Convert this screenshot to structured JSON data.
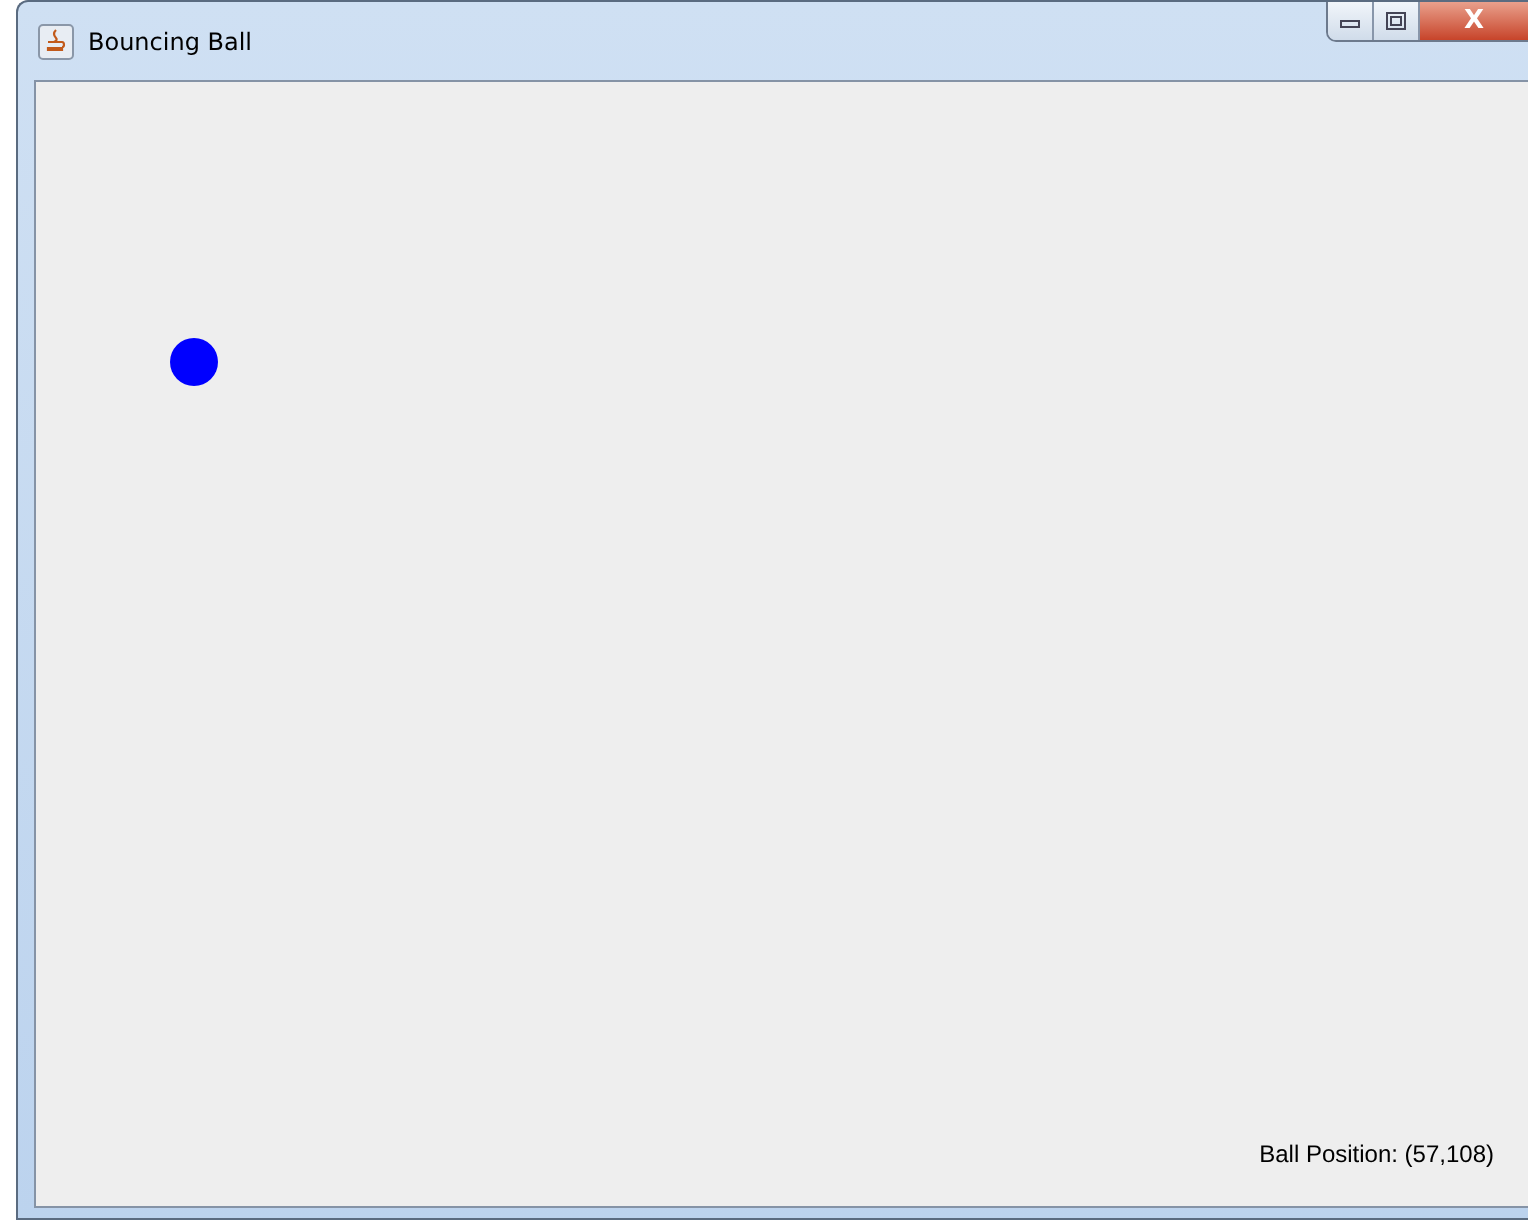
{
  "window": {
    "title": "Bouncing Ball",
    "close_glyph": "X"
  },
  "status": {
    "text": "Ball Position: (57,108)"
  }
}
